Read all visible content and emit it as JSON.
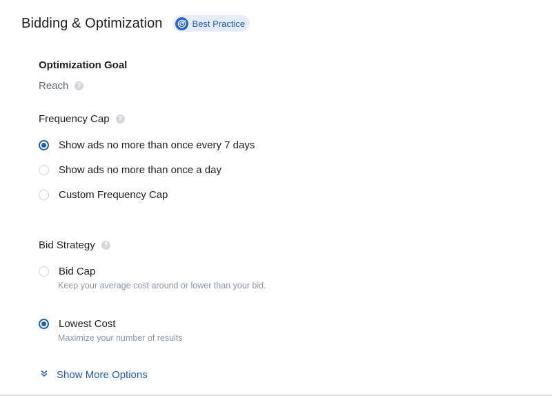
{
  "section": {
    "title": "Bidding & Optimization",
    "badge_label": "Best Practice"
  },
  "optimization_goal": {
    "label": "Optimization Goal",
    "value": "Reach"
  },
  "frequency_cap": {
    "label": "Frequency Cap",
    "options": [
      {
        "label": "Show ads no more than once every 7 days",
        "selected": true
      },
      {
        "label": "Show ads no more than once a day",
        "selected": false
      },
      {
        "label": "Custom Frequency Cap",
        "selected": false
      }
    ]
  },
  "bid_strategy": {
    "label": "Bid Strategy",
    "options": [
      {
        "label": "Bid Cap",
        "description": "Keep your average cost around or lower than your bid.",
        "selected": false
      },
      {
        "label": "Lowest Cost",
        "description": "Maximize your number of results",
        "selected": true
      }
    ]
  },
  "show_more": {
    "label": "Show More Options"
  },
  "colors": {
    "accent": "#1d5bbf",
    "help_icon": "#d3d6db",
    "muted_text": "#8d949e"
  }
}
